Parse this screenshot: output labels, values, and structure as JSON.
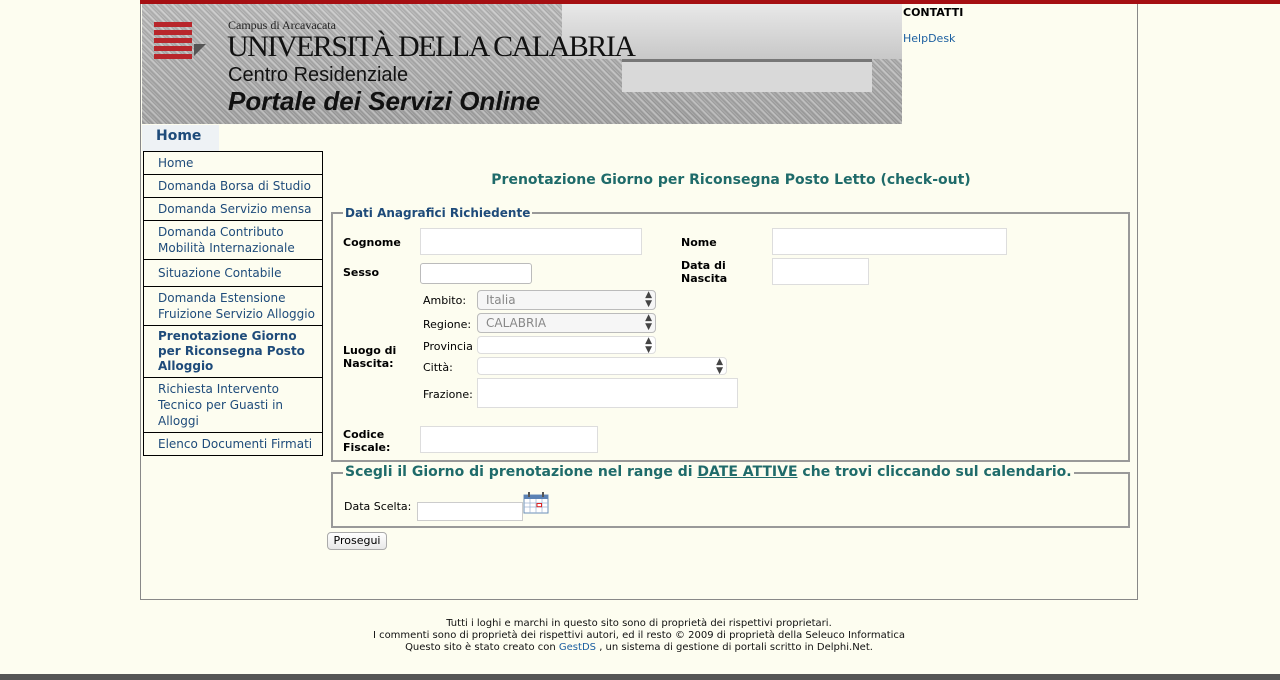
{
  "header": {
    "campus": "Campus di Arcavacata",
    "university": "UNIVERSITÀ DELLA CALABRIA",
    "centro": "Centro Residenziale",
    "portale": "Portale dei Servizi Online",
    "contatti": "CONTATTI",
    "helpdesk": "HelpDesk",
    "home_tab": "Home"
  },
  "sidebar": {
    "items": [
      {
        "label": "Home"
      },
      {
        "label": "Domanda Borsa di Studio"
      },
      {
        "label": "Domanda Servizio mensa"
      },
      {
        "label": "Domanda Contributo Mobilità Internazionale"
      },
      {
        "label": "Situazione Contabile"
      },
      {
        "label": "Domanda Estensione Fruizione Servizio Alloggio"
      },
      {
        "label": "Prenotazione Giorno per Riconsegna Posto Alloggio",
        "active": true
      },
      {
        "label": "Richiesta Intervento Tecnico per Guasti in Alloggi"
      },
      {
        "label": "Elenco Documenti Firmati"
      }
    ]
  },
  "main": {
    "title": "Prenotazione Giorno per Riconsegna Posto Letto (check-out)",
    "anagrafica": {
      "legend": "Dati Anagrafici Richiedente",
      "cognome_label": "Cognome",
      "nome_label": "Nome",
      "sesso_label": "Sesso",
      "data_nascita_label": "Data di Nascita",
      "luogo_label": "Luogo di Nascita:",
      "ambito_label": "Ambito:",
      "ambito_value": "Italia",
      "regione_label": "Regione:",
      "regione_value": "CALABRIA",
      "provincia_label": "Provincia",
      "citta_label": "Città:",
      "frazione_label": "Frazione:",
      "codice_label": "Codice Fiscale:"
    },
    "prenotazione": {
      "legend_pre": "Scegli il Giorno di prenotazione nel range di",
      "legend_link": "DATE ATTIVE",
      "legend_post": "che trovi cliccando sul calendario.",
      "data_label": "Data Scelta:"
    },
    "submit_label": "Prosegui"
  },
  "footer": {
    "line1": "Tutti i loghi e marchi in questo sito sono di proprietà dei rispettivi proprietari.",
    "line2": "I commenti sono di proprietà dei rispettivi autori, ed il resto © 2009 di proprietà della Seleuco Informatica",
    "line3_pre": "Questo sito è stato creato con",
    "line3_link": "GestDS",
    "line3_post": ", un sistema di gestione di portali scritto in Delphi.Net."
  }
}
